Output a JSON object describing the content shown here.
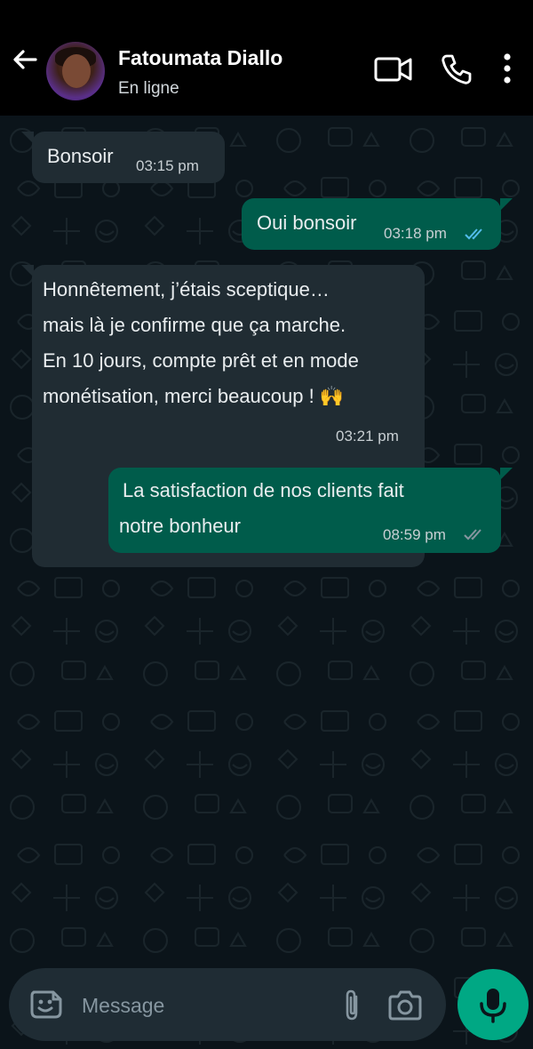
{
  "contact": {
    "name": "Fatoumata Diallo",
    "status": "En ligne"
  },
  "header_icons": [
    "back-arrow-icon",
    "video-call-icon",
    "voice-call-icon",
    "more-options-icon"
  ],
  "messages": [
    {
      "direction": "incoming",
      "text": "Bonsoir",
      "time": "03:15 pm"
    },
    {
      "direction": "outgoing",
      "text": "Oui bonsoir",
      "time": "03:18 pm",
      "ticks": "read"
    },
    {
      "direction": "incoming",
      "lines": [
        " Honnêtement, j’étais sceptique…",
        "mais là je confirme que ça marche.",
        "En 10 jours, compte prêt et en mode",
        "monétisation, merci beaucoup ! 🙌"
      ],
      "time": "03:21 pm"
    },
    {
      "direction": "outgoing",
      "lines": [
        "La satisfaction de nos clients fait",
        "notre bonheur"
      ],
      "time": "08:59 pm",
      "ticks": "delivered"
    }
  ],
  "composer": {
    "placeholder": "Message"
  },
  "colors": {
    "header_bg": "#000000",
    "chat_bg": "#0b141a",
    "incoming_bubble": "#202c33",
    "outgoing_bubble": "#005c4b",
    "read_ticks": "#53bdeb",
    "mic_button": "#00a884"
  }
}
